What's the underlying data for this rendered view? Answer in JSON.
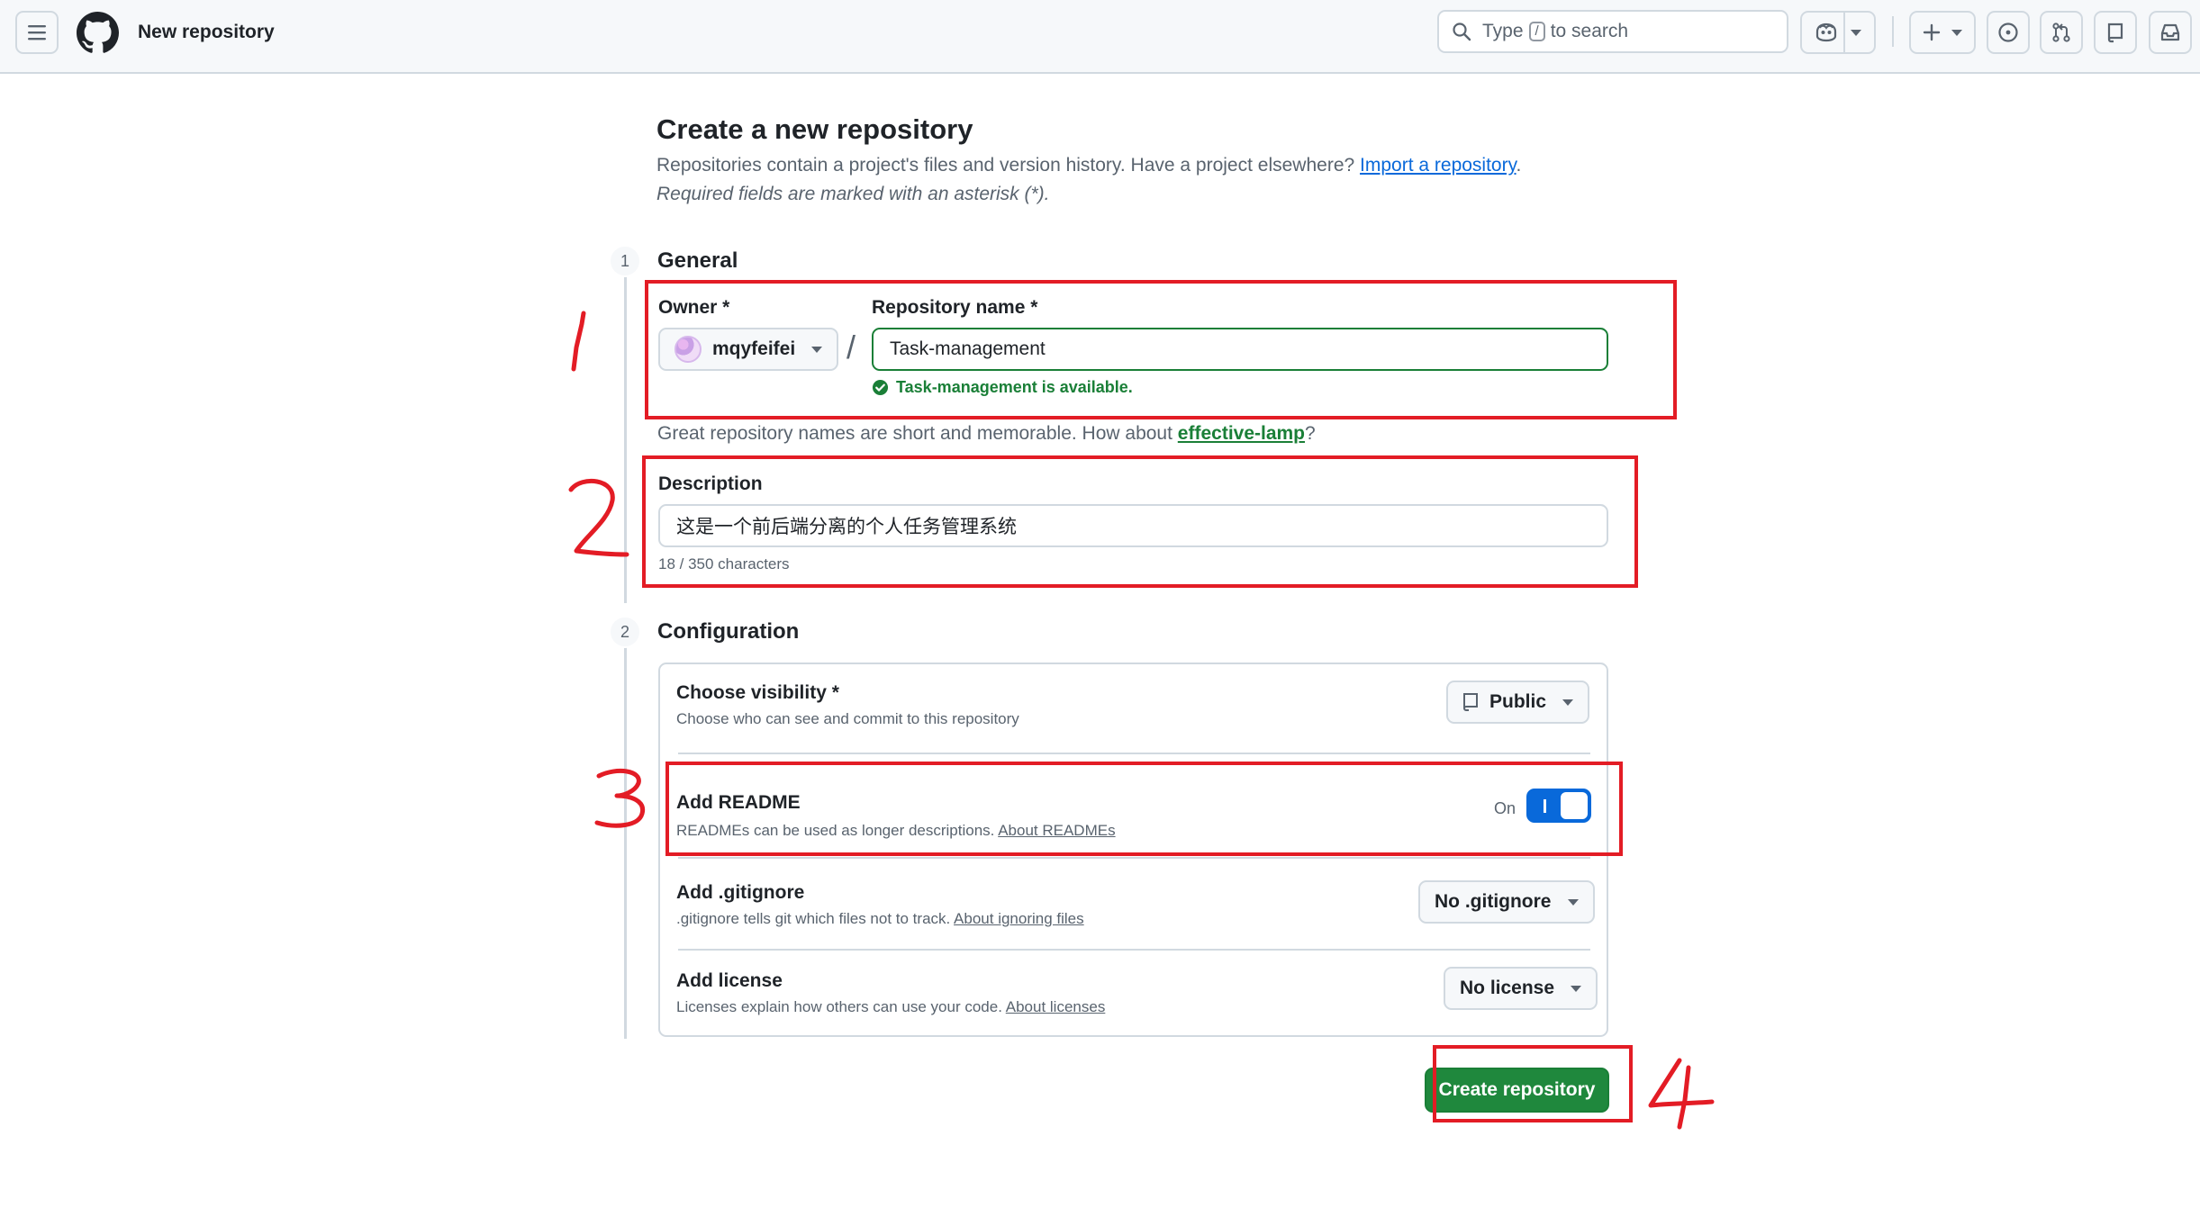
{
  "header": {
    "page_title": "New repository",
    "search": {
      "prefix": "Type",
      "key": "/",
      "suffix": "to search"
    }
  },
  "main": {
    "heading": "Create a new repository",
    "intro": "Repositories contain a project's files and version history. Have a project elsewhere?",
    "import_link": "Import a repository",
    "intro_end": ".",
    "required_note": "Required fields are marked with an asterisk (*)."
  },
  "general": {
    "step": "1",
    "title": "General",
    "owner_label": "Owner *",
    "owner_value": "mqyfeifei",
    "slash": "/",
    "repo_name_label": "Repository name *",
    "repo_name_value": "Task-management",
    "availability": "Task-management is available.",
    "hint_text": "Great repository names are short and memorable. How about",
    "hint_link": "effective-lamp",
    "hint_end": "?",
    "description_label": "Description",
    "description_value": "这是一个前后端分离的个人任务管理系统",
    "description_count": "18 / 350 characters"
  },
  "configuration": {
    "step": "2",
    "title": "Configuration",
    "visibility": {
      "title": "Choose visibility *",
      "subtitle": "Choose who can see and commit to this repository",
      "value": "Public"
    },
    "readme": {
      "title": "Add README",
      "subtitle": "READMEs can be used as longer descriptions.",
      "link": "About READMEs",
      "toggle_label": "On",
      "toggle_on": true
    },
    "gitignore": {
      "title": "Add .gitignore",
      "subtitle": ".gitignore tells git which files not to track.",
      "link": "About ignoring files",
      "value": "No .gitignore"
    },
    "license": {
      "title": "Add license",
      "subtitle": "Licenses explain how others can use your code.",
      "link": "About licenses",
      "value": "No license"
    }
  },
  "actions": {
    "create_label": "Create repository"
  },
  "annotations": {
    "color": "#e31c25",
    "numbers": [
      "1",
      "2",
      "3",
      "4"
    ]
  },
  "colors": {
    "accent_blue": "#0969da",
    "success_green": "#1a7f37",
    "primary_button": "#1f883d"
  }
}
